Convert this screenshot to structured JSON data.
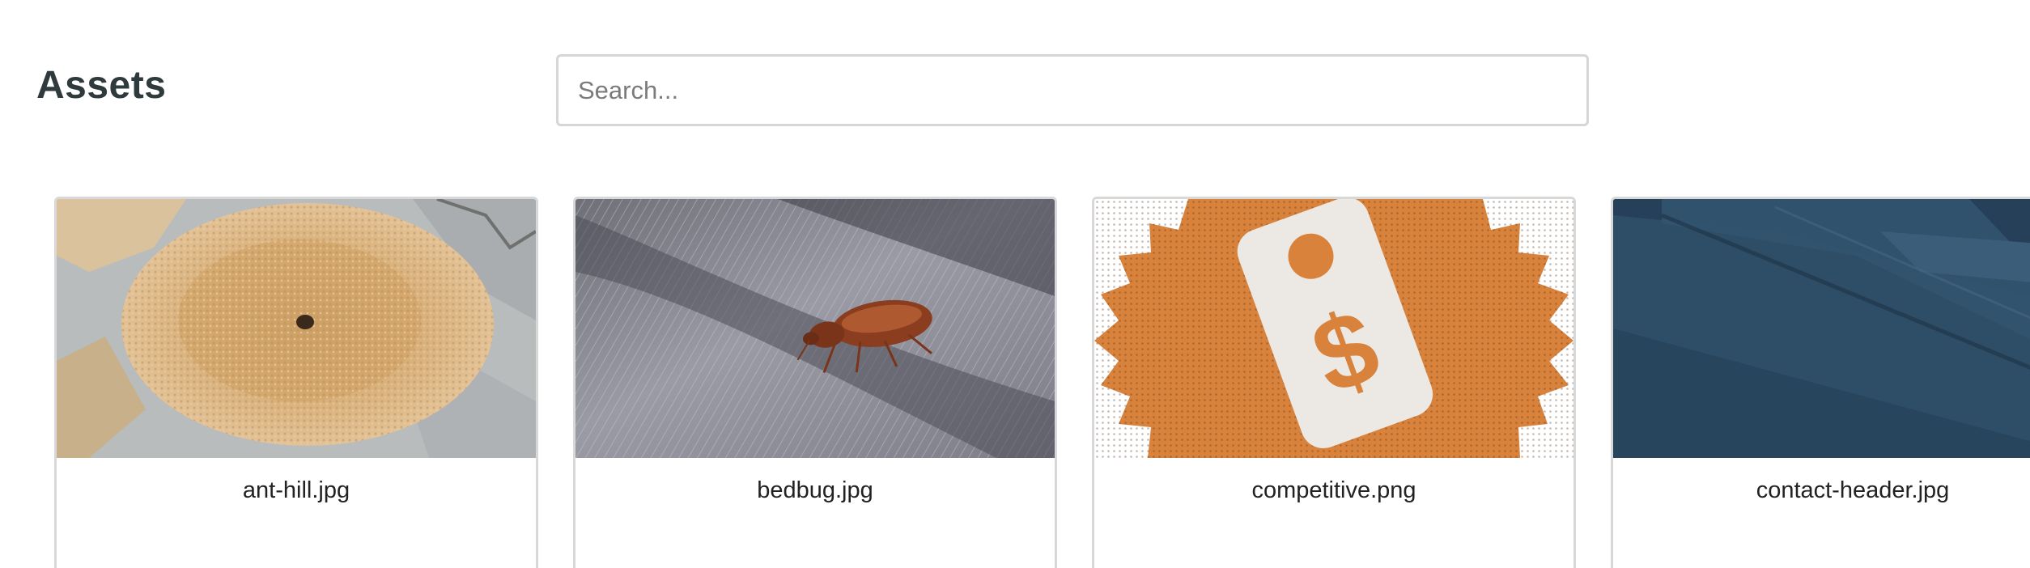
{
  "header": {
    "title": "Assets"
  },
  "search": {
    "placeholder": "Search...",
    "value": ""
  },
  "assets": [
    {
      "filename": "ant-hill.jpg",
      "thumbnail": "sandy ant hill photo"
    },
    {
      "filename": "bedbug.jpg",
      "thumbnail": "bedbug on grey fabric photo"
    },
    {
      "filename": "competitive.png",
      "thumbnail": "price-tag-icon on orange starburst"
    },
    {
      "filename": "contact-header.jpg",
      "thumbnail": "blue building facade photo"
    }
  ],
  "colors": {
    "title": "#2f3a3d",
    "border": "#d8d8d8",
    "accent_orange": "#d8823c",
    "header_blue": "#2c4a63"
  }
}
